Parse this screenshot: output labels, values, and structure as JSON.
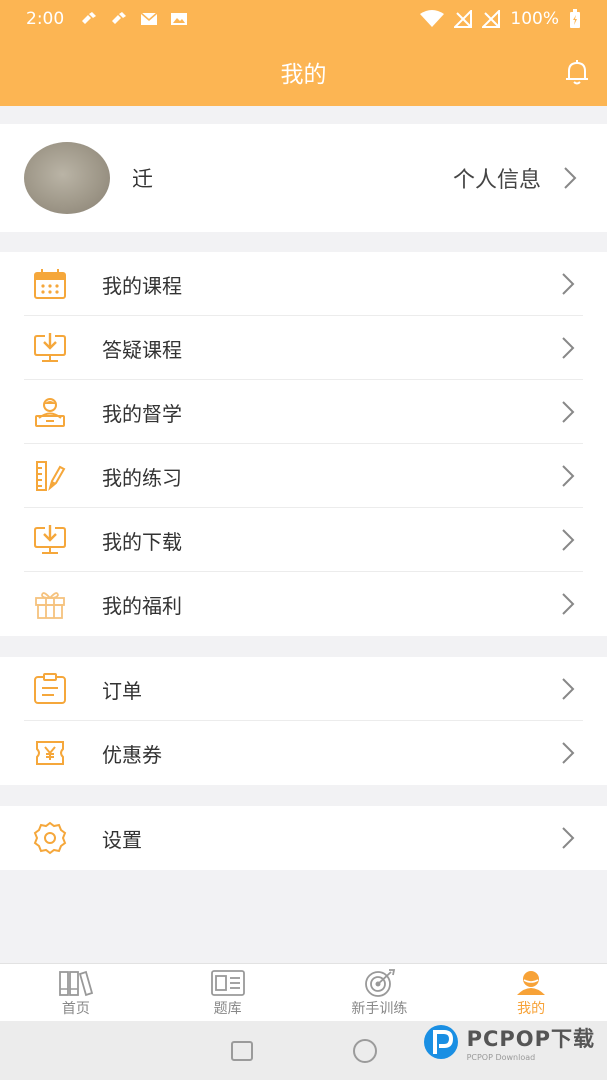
{
  "status_bar": {
    "time": "2:00",
    "battery": "100%"
  },
  "header": {
    "title": "我的"
  },
  "profile": {
    "name": "迁",
    "info_link": "个人信息"
  },
  "menu_main": [
    {
      "label": "我的课程",
      "icon": "calendar-icon"
    },
    {
      "label": "答疑课程",
      "icon": "monitor-download-icon"
    },
    {
      "label": "我的督学",
      "icon": "tutor-icon"
    },
    {
      "label": "我的练习",
      "icon": "ruler-pencil-icon"
    },
    {
      "label": "我的下载",
      "icon": "monitor-download-icon"
    },
    {
      "label": "我的福利",
      "icon": "gift-icon"
    }
  ],
  "menu_orders": [
    {
      "label": "订单",
      "icon": "clipboard-icon"
    },
    {
      "label": "优惠券",
      "icon": "coupon-icon"
    }
  ],
  "menu_settings": [
    {
      "label": "设置",
      "icon": "gear-icon"
    }
  ],
  "tabs": [
    {
      "label": "首页",
      "icon": "books-icon",
      "active": false
    },
    {
      "label": "题库",
      "icon": "question-bank-icon",
      "active": false
    },
    {
      "label": "新手训练",
      "icon": "target-icon",
      "active": false
    },
    {
      "label": "我的",
      "icon": "profile-icon",
      "active": true
    }
  ],
  "colors": {
    "accent": "#fcb553",
    "icon": "#f5a73b",
    "active_tab": "#f7a237",
    "background": "#f2f2f4"
  },
  "watermark": {
    "main": "PCPOP下载",
    "sub": "PCPOP Download"
  }
}
